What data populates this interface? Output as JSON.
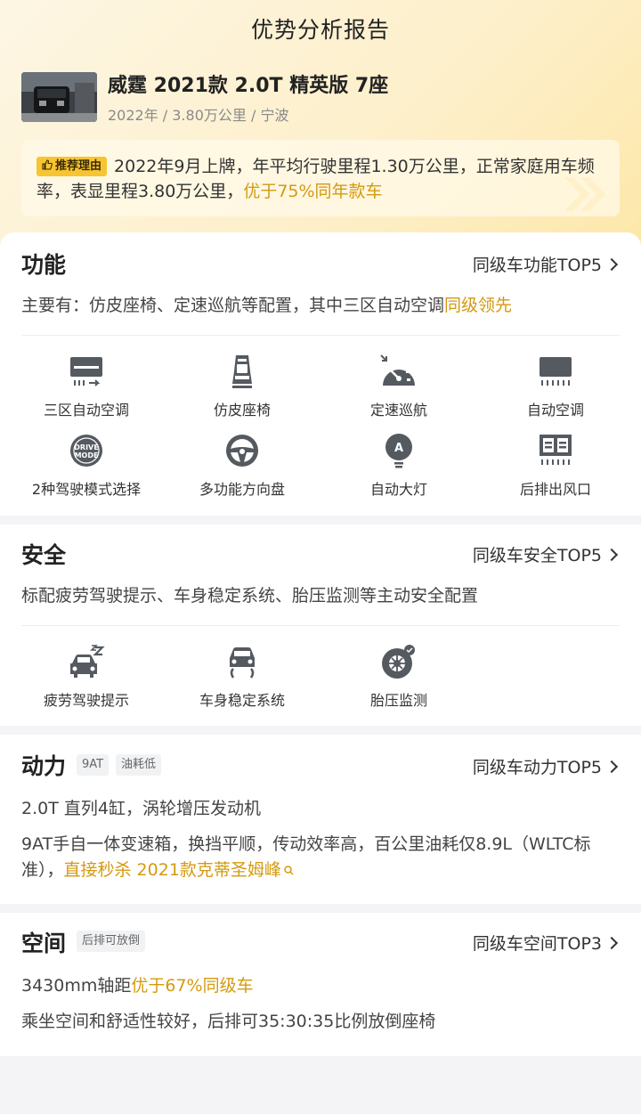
{
  "header": {
    "title": "优势分析报告"
  },
  "car": {
    "name": "威霆 2021款 2.0T 精英版 7座",
    "meta": "2022年 / 3.80万公里 / 宁波"
  },
  "reason": {
    "tag": "推荐理由",
    "text": "2022年9月上牌，年平均行驶里程1.30万公里，正常家庭用车频率，表显里程3.80万公里，",
    "highlight": "优于75%同年款车"
  },
  "function": {
    "title": "功能",
    "more": "同级车功能TOP5",
    "desc": "主要有：仿皮座椅、定速巡航等配置，其中三区自动空调",
    "desc_highlight": "同级领先",
    "items": [
      {
        "label": "三区自动空调",
        "icon": "ac-vent-icon"
      },
      {
        "label": "仿皮座椅",
        "icon": "seat-icon"
      },
      {
        "label": "定速巡航",
        "icon": "cruise-gauge-icon"
      },
      {
        "label": "自动空调",
        "icon": "auto-ac-icon"
      },
      {
        "label": "2种驾驶模式选择",
        "icon": "drive-mode-icon",
        "badge": "DRIVE MODE"
      },
      {
        "label": "多功能方向盘",
        "icon": "steering-wheel-icon"
      },
      {
        "label": "自动大灯",
        "icon": "auto-headlight-icon",
        "badge": "A"
      },
      {
        "label": "后排出风口",
        "icon": "rear-vent-icon"
      }
    ]
  },
  "safety": {
    "title": "安全",
    "more": "同级车安全TOP5",
    "desc": "标配疲劳驾驶提示、车身稳定系统、胎压监测等主动安全配置",
    "items": [
      {
        "label": "疲劳驾驶提示",
        "icon": "fatigue-car-icon"
      },
      {
        "label": "车身稳定系统",
        "icon": "stability-car-icon"
      },
      {
        "label": "胎压监测",
        "icon": "tire-pressure-icon"
      }
    ]
  },
  "power": {
    "title": "动力",
    "tags": [
      "9AT",
      "油耗低"
    ],
    "more": "同级车动力TOP5",
    "line1": "2.0T 直列4缸，涡轮增压发动机",
    "line2": "9AT手自一体变速箱，换挡平顺，传动效率高，百公里油耗仅8.9L（WLTC标准），",
    "line2_highlight": "直接秒杀 2021款克蒂圣姆峰"
  },
  "space": {
    "title": "空间",
    "tag": "后排可放倒",
    "more": "同级车空间TOP3",
    "line1": "3430mm轴距",
    "line1_highlight": "优于67%同级车",
    "line2": "乘坐空间和舒适性较好，后排可35:30:35比例放倒座椅"
  },
  "colors": {
    "accent": "#d49a10",
    "tag_yellow": "#f6c531",
    "icon_gray": "#555a61"
  }
}
